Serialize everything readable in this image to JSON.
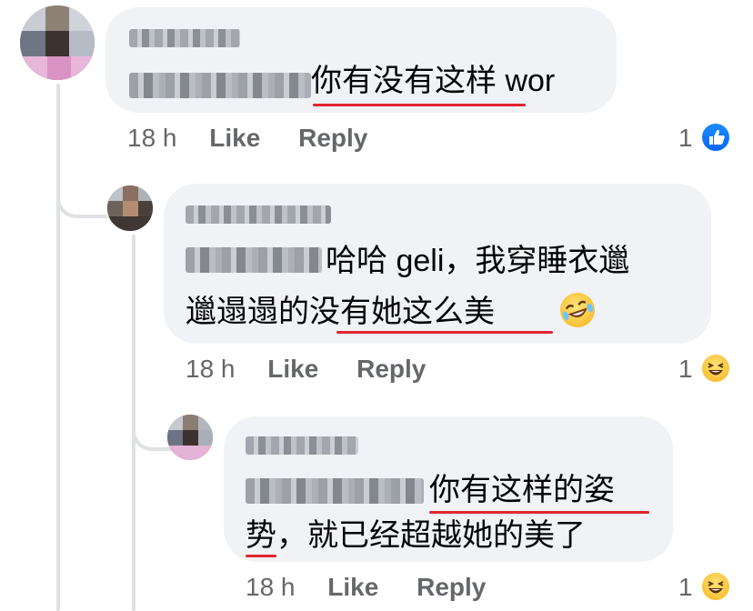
{
  "comments": [
    {
      "author": "",
      "text": "你有没有这样 wor",
      "time": "18 h",
      "like_label": "Like",
      "reply_label": "Reply",
      "reaction_count": "1",
      "reaction_icon": "like-reaction-icon"
    },
    {
      "author": "",
      "text_line1": "哈哈 geli，我穿睡衣邋",
      "text_line2": "邋遢遢的没有她这么美",
      "emoji": "rolling-on-floor-laughing-icon",
      "time": "18 h",
      "like_label": "Like",
      "reply_label": "Reply",
      "reaction_count": "1",
      "reaction_icon": "haha-reaction-icon"
    },
    {
      "author": "",
      "text_line1": "你有这样的姿",
      "text_line2": "势，就已经超越她的美了",
      "time": "18 h",
      "like_label": "Like",
      "reply_label": "Reply",
      "reaction_count": "1",
      "reaction_icon": "haha-reaction-icon"
    }
  ],
  "colors": {
    "bubble": "#f0f2f5",
    "text": "#050505",
    "meta": "#65676b",
    "underline": "#e0262e",
    "like_blue": "#0866ff",
    "thread_line": "#dfe1e5"
  }
}
